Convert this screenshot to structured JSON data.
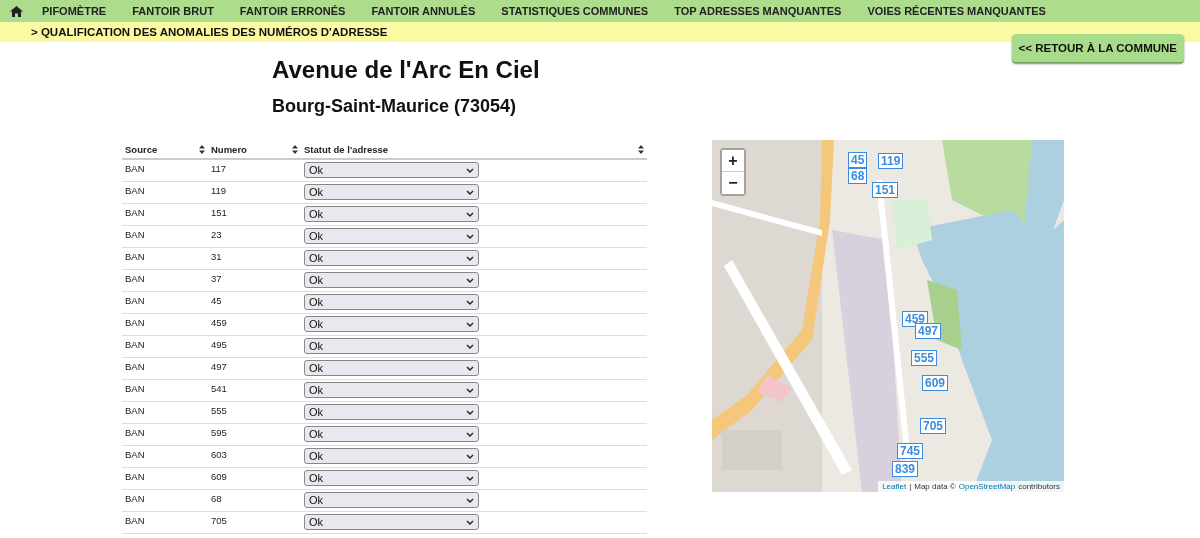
{
  "nav": {
    "items": [
      {
        "label": "PIFOMÈTRE"
      },
      {
        "label": "FANTOIR BRUT"
      },
      {
        "label": "FANTOIR ERRONÉS"
      },
      {
        "label": "FANTOIR ANNULÉS"
      },
      {
        "label": "STATISTIQUES COMMUNES"
      },
      {
        "label": "TOP ADRESSES MANQUANTES"
      },
      {
        "label": "VOIES RÉCENTES MANQUANTES"
      }
    ]
  },
  "breadcrumb": "> QUALIFICATION DES ANOMALIES DES NUMÉROS D'ADRESSE",
  "back_button": "<< RETOUR À LA COMMUNE",
  "title": "Avenue de l'Arc En Ciel",
  "subtitle": "Bourg-Saint-Maurice (73054)",
  "table": {
    "columns": [
      "Source",
      "Numero",
      "Statut de l'adresse"
    ],
    "rows": [
      {
        "source": "BAN",
        "numero": "117",
        "statut": "Ok"
      },
      {
        "source": "BAN",
        "numero": "119",
        "statut": "Ok"
      },
      {
        "source": "BAN",
        "numero": "151",
        "statut": "Ok"
      },
      {
        "source": "BAN",
        "numero": "23",
        "statut": "Ok"
      },
      {
        "source": "BAN",
        "numero": "31",
        "statut": "Ok"
      },
      {
        "source": "BAN",
        "numero": "37",
        "statut": "Ok"
      },
      {
        "source": "BAN",
        "numero": "45",
        "statut": "Ok"
      },
      {
        "source": "BAN",
        "numero": "459",
        "statut": "Ok"
      },
      {
        "source": "BAN",
        "numero": "495",
        "statut": "Ok"
      },
      {
        "source": "BAN",
        "numero": "497",
        "statut": "Ok"
      },
      {
        "source": "BAN",
        "numero": "541",
        "statut": "Ok"
      },
      {
        "source": "BAN",
        "numero": "555",
        "statut": "Ok"
      },
      {
        "source": "BAN",
        "numero": "595",
        "statut": "Ok"
      },
      {
        "source": "BAN",
        "numero": "603",
        "statut": "Ok"
      },
      {
        "source": "BAN",
        "numero": "609",
        "statut": "Ok"
      },
      {
        "source": "BAN",
        "numero": "68",
        "statut": "Ok"
      },
      {
        "source": "BAN",
        "numero": "705",
        "statut": "Ok"
      }
    ]
  },
  "map": {
    "zoom_in": "+",
    "zoom_out": "−",
    "markers": [
      {
        "label": "45"
      },
      {
        "label": "119"
      },
      {
        "label": "68"
      },
      {
        "label": "151"
      },
      {
        "label": "459"
      },
      {
        "label": "497"
      },
      {
        "label": "555"
      },
      {
        "label": "609"
      },
      {
        "label": "705"
      },
      {
        "label": "745"
      },
      {
        "label": "839"
      }
    ],
    "attribution": {
      "link": "Leaflet",
      "separator": "|",
      "text": "Map data ©",
      "osm_link": "OpenStreetMap",
      "suffix": "contributors"
    }
  }
}
